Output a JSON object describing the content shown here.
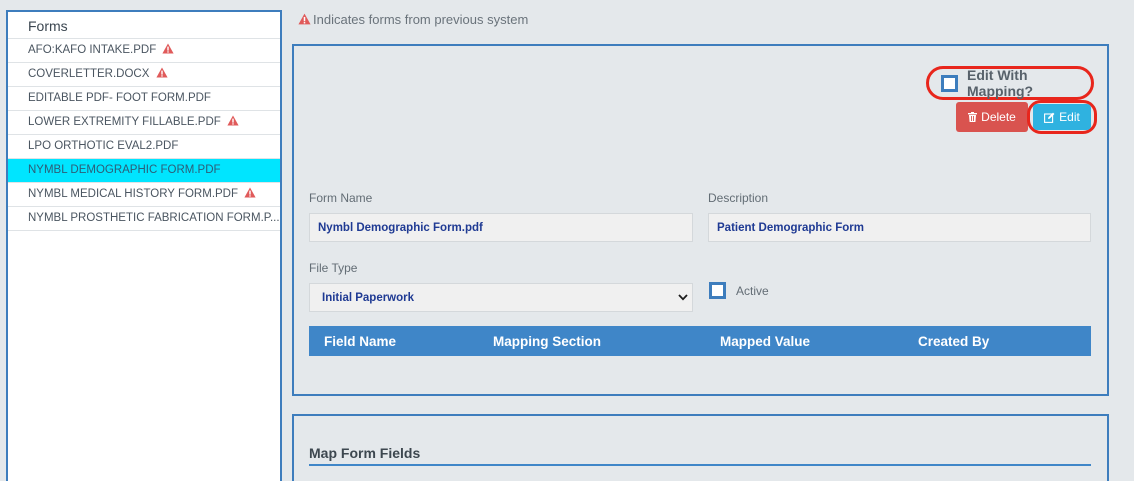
{
  "forms_panel": {
    "title": "Forms",
    "items": [
      {
        "label": "AFO:KAFO INTAKE.PDF",
        "legacy": true,
        "selected": false
      },
      {
        "label": "COVERLETTER.DOCX",
        "legacy": true,
        "selected": false
      },
      {
        "label": "EDITABLE PDF- FOOT FORM.PDF",
        "legacy": false,
        "selected": false
      },
      {
        "label": "LOWER EXTREMITY FILLABLE.PDF",
        "legacy": true,
        "selected": false
      },
      {
        "label": "LPO ORTHOTIC EVAL2.PDF",
        "legacy": false,
        "selected": false
      },
      {
        "label": "NYMBL DEMOGRAPHIC FORM.PDF",
        "legacy": false,
        "selected": true
      },
      {
        "label": "NYMBL MEDICAL HISTORY FORM.PDF",
        "legacy": true,
        "selected": false
      },
      {
        "label": "NYMBL PROSTHETIC FABRICATION FORM.P...",
        "legacy": false,
        "selected": false
      }
    ]
  },
  "info": {
    "text": "Indicates forms from previous system",
    "icon": "warning-triangle-icon"
  },
  "form_detail": {
    "edit_with_mapping_label": "Edit With Mapping?",
    "edit_with_mapping_checked": false,
    "delete_label": "Delete",
    "delete_icon": "trash-icon",
    "edit_label": "Edit",
    "edit_icon": "pencil-square-icon",
    "form_name_label": "Form Name",
    "form_name_value": "Nymbl Demographic Form.pdf",
    "description_label": "Description",
    "description_value": "Patient Demographic Form",
    "file_type_label": "File Type",
    "file_type_value": "Initial Paperwork",
    "active_label": "Active",
    "active_checked": false,
    "table_headers": [
      "Field Name",
      "Mapping Section",
      "Mapped Value",
      "Created By"
    ]
  },
  "map_section": {
    "title": "Map Form Fields"
  },
  "colors": {
    "accent_blue": "#3d7dbd",
    "table_header": "#3f86c8",
    "selected_row": "#00e5ff",
    "warning_red": "#e05a5a",
    "delete_red": "#d9534f",
    "edit_blue": "#2fb2e0",
    "highlight_ring": "#e8261c",
    "value_text": "#1f3a93"
  }
}
